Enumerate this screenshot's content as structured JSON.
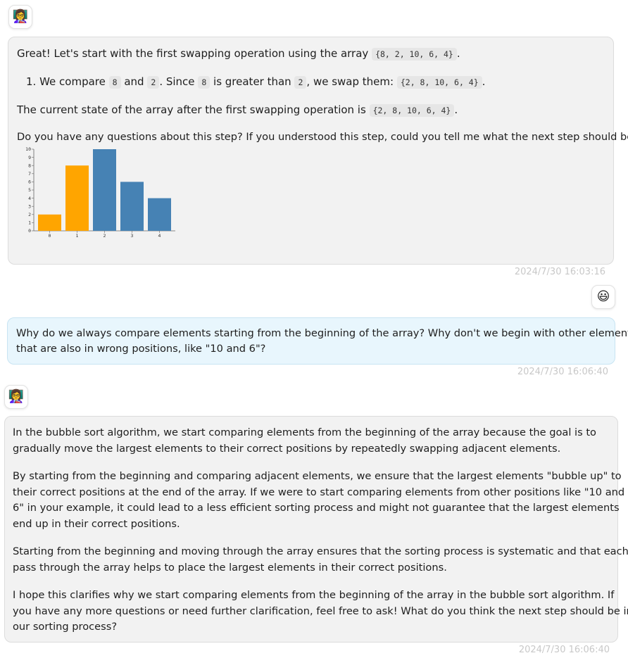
{
  "messages": [
    {
      "role": "assistant",
      "avatar_icon": "woman-teacher-emoji",
      "avatar_glyph": "👩‍🏫",
      "intro_text": "Great! Let's start with the first swapping operation using the array",
      "intro_code": "{8, 2, 10, 6, 4}",
      "step": {
        "number": "1.",
        "t1": "We compare",
        "c1": "8",
        "t2": "and",
        "c2": "2",
        "t3": ". Since",
        "c3": "8",
        "t4": "is greater than",
        "c4": "2",
        "t5": ", we swap them:",
        "c5": "{2, 8, 10, 6, 4}"
      },
      "state_text": "The current state of the array after the first swapping operation is",
      "state_code": "{2, 8, 10, 6, 4}",
      "question_text": "Do you have any questions about this step? If you understood this step, could you tell me what the next step should be?",
      "timestamp": "2024/7/30 16:03:16"
    },
    {
      "role": "user",
      "avatar_icon": "smiley-emoji",
      "avatar_glyph": "😃",
      "line1": "Why do we always compare elements starting from the beginning of the array? Why don't we begin with other elements",
      "line2": "that are also in wrong positions, like \"10 and 6\"?",
      "timestamp": "2024/7/30 16:06:40"
    },
    {
      "role": "assistant",
      "avatar_icon": "woman-teacher-emoji",
      "avatar_glyph": "👩‍🏫",
      "paragraphs": [
        [
          "In the bubble sort algorithm, we start comparing elements from the beginning of the array because the goal is to",
          "gradually move the largest elements to their correct positions by repeatedly swapping adjacent elements."
        ],
        [
          "By starting from the beginning and comparing adjacent elements, we ensure that the largest elements \"bubble up\" to",
          "their correct positions at the end of the array. If we were to start comparing elements from other positions like \"10 and",
          "6\" in your example, it could lead to a less efficient sorting process and might not guarantee that the largest elements",
          "end up in their correct positions."
        ],
        [
          "Starting from the beginning and moving through the array ensures that the sorting process is systematic and that each",
          "pass through the array helps to place the largest elements in their correct positions."
        ],
        [
          "I hope this clarifies why we start comparing elements from the beginning of the array in the bubble sort algorithm. If",
          "you have any more questions or need further clarification, feel free to ask! What do you think the next step should be in",
          "our sorting process?"
        ]
      ],
      "timestamp": "2024/7/30 16:06:40"
    }
  ],
  "chart_data": {
    "type": "bar",
    "categories": [
      "0",
      "1",
      "2",
      "3",
      "4"
    ],
    "values": [
      2,
      8,
      10,
      6,
      4
    ],
    "bar_colors": [
      "#ffa500",
      "#ffa500",
      "#4682b4",
      "#4682b4",
      "#4682b4"
    ],
    "ylim": [
      0,
      10
    ],
    "yticks": [
      "0",
      "1",
      "2",
      "3",
      "4",
      "5",
      "6",
      "7",
      "8",
      "9",
      "10"
    ],
    "title": "",
    "xlabel": "",
    "ylabel": "",
    "grid": false,
    "legend": "none"
  }
}
